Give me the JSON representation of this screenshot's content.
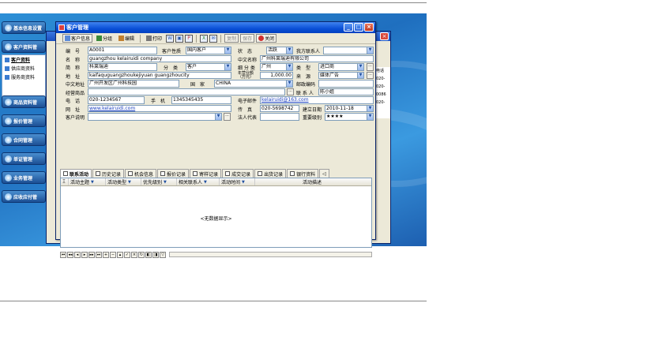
{
  "nav": {
    "items": [
      "基本信息设置",
      "客户资料管",
      "商品资料管",
      "报价管理",
      "合同管理",
      "单证管理",
      "业务管理",
      "应收应付管"
    ],
    "sub_items": [
      "客户资料",
      "供应商资料",
      "服务商资料"
    ]
  },
  "back_window": {
    "side_values": [
      "电话",
      "020-",
      "020-",
      "0086",
      "020-"
    ]
  },
  "window": {
    "title": "客户管理",
    "minimize": "_",
    "maximize": "□",
    "close": "×"
  },
  "toolbar": {
    "customer_info": "客户信息",
    "grouping": "分组",
    "edit": "编辑",
    "print": "打印",
    "copy": "复制",
    "save": "保存",
    "close": "关闭"
  },
  "form": {
    "code_label": "编　号",
    "code": "A0001",
    "nature_label": "客户性质",
    "nature": "国内客户",
    "status_label": "状　态",
    "status": "活跃",
    "contact_label": "我方联系人",
    "contact": "",
    "name_label": "名　称",
    "name": "guangzhou kelairuidi company",
    "cn_name_label": "中文名称",
    "cn_name": "广州科莱瑞迪有限公司",
    "brief_label": "简　称",
    "brief": "科莱瑞迪",
    "category_label": "分　类",
    "category": "客户",
    "region_label": "细 分 类",
    "region": "广州",
    "type_label": "类　型",
    "type": "进口商",
    "address_label": "地　址",
    "address": "kaifaquguangzhoukejiyuan guangzhoucity",
    "turnover_label": "年营业额（万元）",
    "turnover": "1,000.00",
    "source_label": "来　源",
    "source": "媒体广告",
    "cn_address_label": "中文地址",
    "cn_address": "广州开发区广州科技园",
    "country_label": "国　家",
    "country": "CHINA",
    "postcode_label": "邮政编码",
    "postcode": "",
    "products_label": "经营商品",
    "products": "",
    "linkman_label": "联 系 人",
    "linkman": "陈小姐",
    "phone_label": "电　话",
    "phone": "020-1234567",
    "mobile_label": "手　机",
    "mobile": "1345345435",
    "email_label": "电子邮件",
    "email": "kelairuidi@163.com",
    "website_label": "网　址",
    "website": "www.kelairuidi.com",
    "fax_label": "传　真",
    "fax": "020-5698742",
    "created_label": "建立日期",
    "created": "2010-11-18",
    "desc_label": "客户说明",
    "desc": "",
    "legal_label": "法人代表",
    "legal": "",
    "level_label": "重要级别",
    "level": "★★★★"
  },
  "tabs": [
    "联系活动",
    "历史记录",
    "机会信息",
    "报价记录",
    "寄样记录",
    "成交记录",
    "出货记录",
    "银行资料"
  ],
  "grid": {
    "columns": [
      "活动主题",
      "活动类型",
      "优先级别",
      "相关联系人",
      "活动时间",
      "活动描述"
    ],
    "empty_text": "<无数据显示>"
  }
}
